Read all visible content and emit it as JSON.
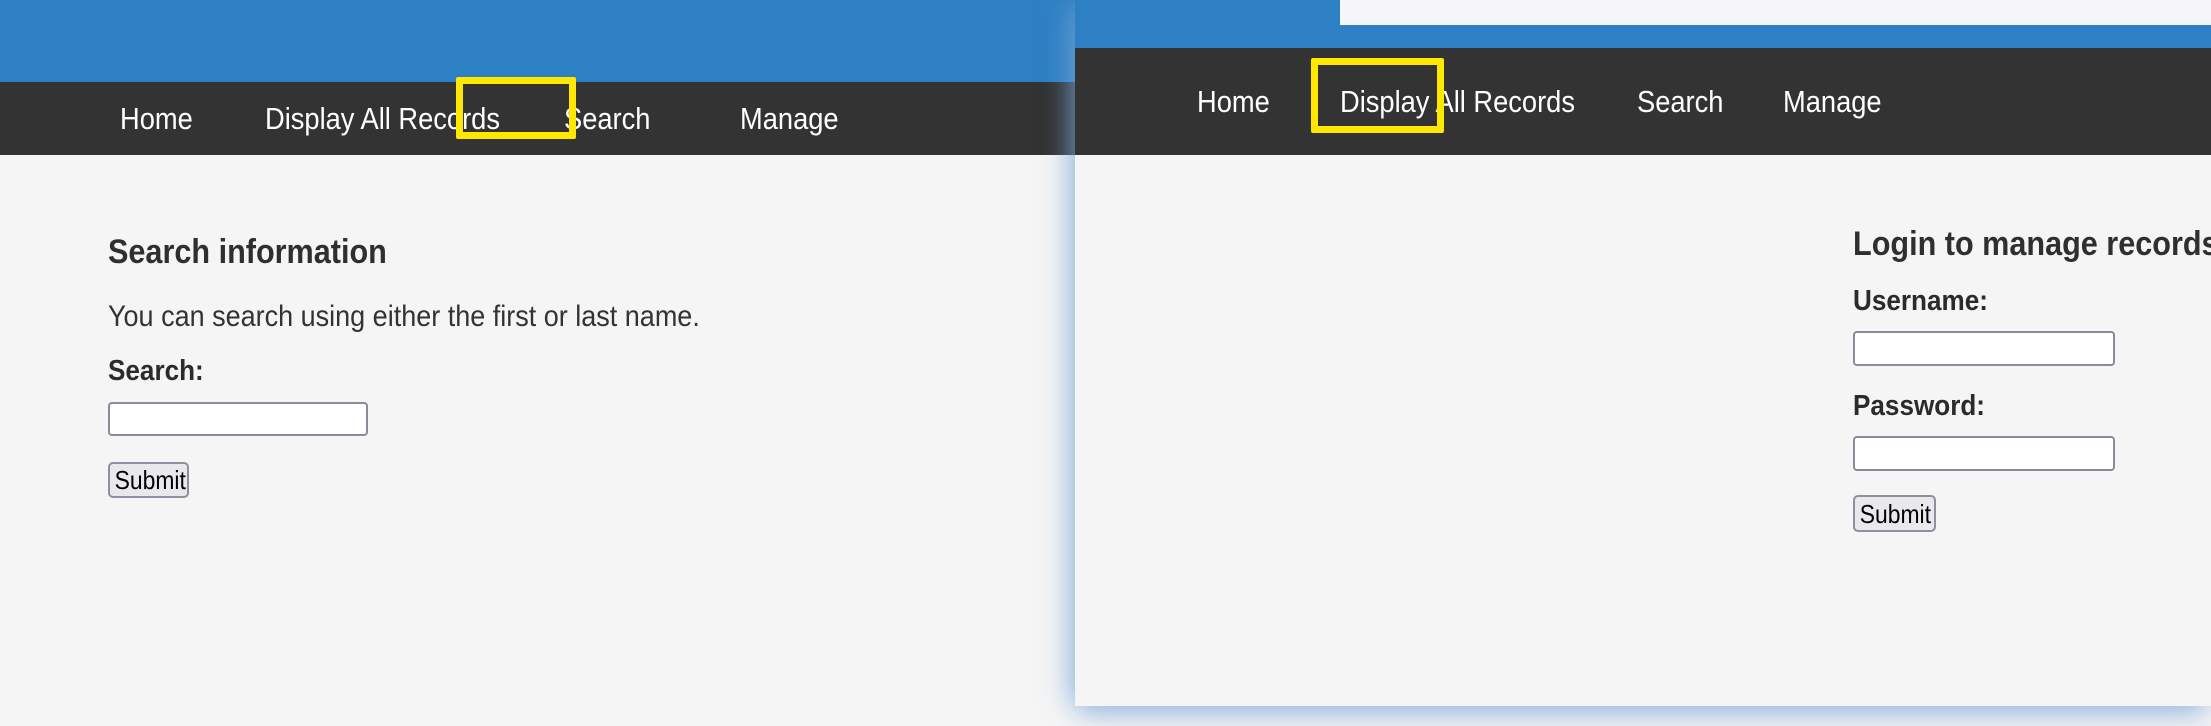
{
  "theme": {
    "brand_blue": "#2e80c4",
    "nav_dark": "#333333",
    "page_bg": "#f5f5f5",
    "highlight_yellow": "#ffe800",
    "input_border": "#8c8a99",
    "button_bg": "#e9e9ed"
  },
  "left_window": {
    "name": "search-page-window",
    "nav": {
      "items": [
        {
          "label": "Home",
          "name": "nav-link-home",
          "highlighted": false
        },
        {
          "label": "Display All Records",
          "name": "nav-link-display-all-records",
          "highlighted": false
        },
        {
          "label": "Search",
          "name": "nav-link-search",
          "highlighted": true
        },
        {
          "label": "Manage",
          "name": "nav-link-manage",
          "highlighted": false
        }
      ]
    },
    "main": {
      "heading": "Search information",
      "description": "You can search using either the first or last name.",
      "form": {
        "search_label": "Search:",
        "search_value": "",
        "search_placeholder": "",
        "submit_label": "Submit"
      }
    }
  },
  "right_window": {
    "name": "manage-login-window",
    "nav": {
      "items": [
        {
          "label": "Home",
          "name": "nav-link-home",
          "highlighted": false
        },
        {
          "label": "Display All Records",
          "name": "nav-link-display-all-records",
          "highlighted": false
        },
        {
          "label": "Search",
          "name": "nav-link-search",
          "highlighted": false
        },
        {
          "label": "Manage",
          "name": "nav-link-manage",
          "highlighted": true
        }
      ]
    },
    "main": {
      "heading": "Login to manage records.",
      "form": {
        "username_label": "Username:",
        "username_value": "",
        "username_placeholder": "",
        "password_label": "Password:",
        "password_value": "",
        "password_placeholder": "",
        "submit_label": "Submit"
      }
    }
  }
}
